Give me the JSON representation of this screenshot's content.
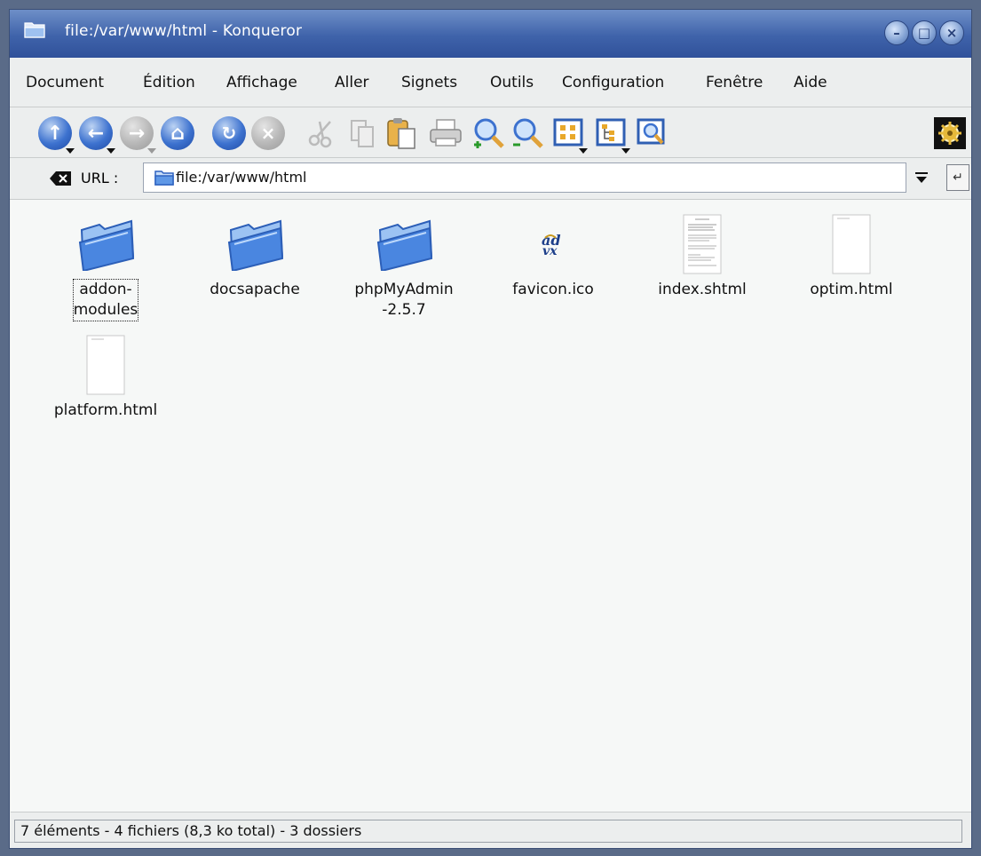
{
  "window": {
    "title": "file:/var/www/html - Konqueror",
    "controls": [
      "minimize-icon",
      "maximize-icon",
      "close-icon"
    ]
  },
  "menubar": {
    "items": [
      {
        "label": "Document"
      },
      {
        "label": "Édition"
      },
      {
        "label": "Affichage"
      },
      {
        "label": "Aller"
      },
      {
        "label": "Signets"
      },
      {
        "label": "Outils"
      },
      {
        "label": "Configuration"
      },
      {
        "label": "Fenêtre"
      },
      {
        "label": "Aide"
      }
    ]
  },
  "toolbar": {
    "buttons": [
      {
        "icon": "up-arrow-icon",
        "enabled": true
      },
      {
        "icon": "back-arrow-icon",
        "enabled": true
      },
      {
        "icon": "forward-arrow-icon",
        "enabled": false
      },
      {
        "icon": "home-icon",
        "enabled": true
      },
      {
        "icon": "reload-icon",
        "enabled": true
      },
      {
        "icon": "stop-icon",
        "enabled": false
      },
      {
        "icon": "cut-icon",
        "enabled": false
      },
      {
        "icon": "copy-icon",
        "enabled": false
      },
      {
        "icon": "paste-icon",
        "enabled": true
      },
      {
        "icon": "print-icon",
        "enabled": true
      },
      {
        "icon": "zoom-in-icon",
        "enabled": true
      },
      {
        "icon": "zoom-out-icon",
        "enabled": true
      },
      {
        "icon": "icon-view-icon",
        "enabled": true
      },
      {
        "icon": "tree-view-icon",
        "enabled": true
      },
      {
        "icon": "preview-icon",
        "enabled": true
      },
      {
        "icon": "konqueror-gear-icon",
        "enabled": true
      }
    ]
  },
  "location": {
    "label": "URL :",
    "value": "file:/var/www/html"
  },
  "files": [
    {
      "name_line1": "addon-",
      "name_line2": "modules",
      "type": "folder",
      "selected": true
    },
    {
      "name_line1": "docsapache",
      "name_line2": "",
      "type": "folder",
      "selected": false
    },
    {
      "name_line1": "phpMyAdmin",
      "name_line2": "-2.5.7",
      "type": "folder",
      "selected": false
    },
    {
      "name_line1": "favicon.ico",
      "name_line2": "",
      "type": "ico",
      "selected": false
    },
    {
      "name_line1": "index.shtml",
      "name_line2": "",
      "type": "document",
      "selected": false
    },
    {
      "name_line1": "optim.html",
      "name_line2": "",
      "type": "blank-document",
      "selected": false
    },
    {
      "name_line1": "platform.html",
      "name_line2": "",
      "type": "blank-document",
      "selected": false
    }
  ],
  "status": {
    "text": "7 éléments - 4 fichiers (8,3 ko total) - 3 dossiers"
  },
  "colors": {
    "titlebar": "#3f63aa",
    "accent": "#3d72cf",
    "folder": "#4a86e0"
  }
}
